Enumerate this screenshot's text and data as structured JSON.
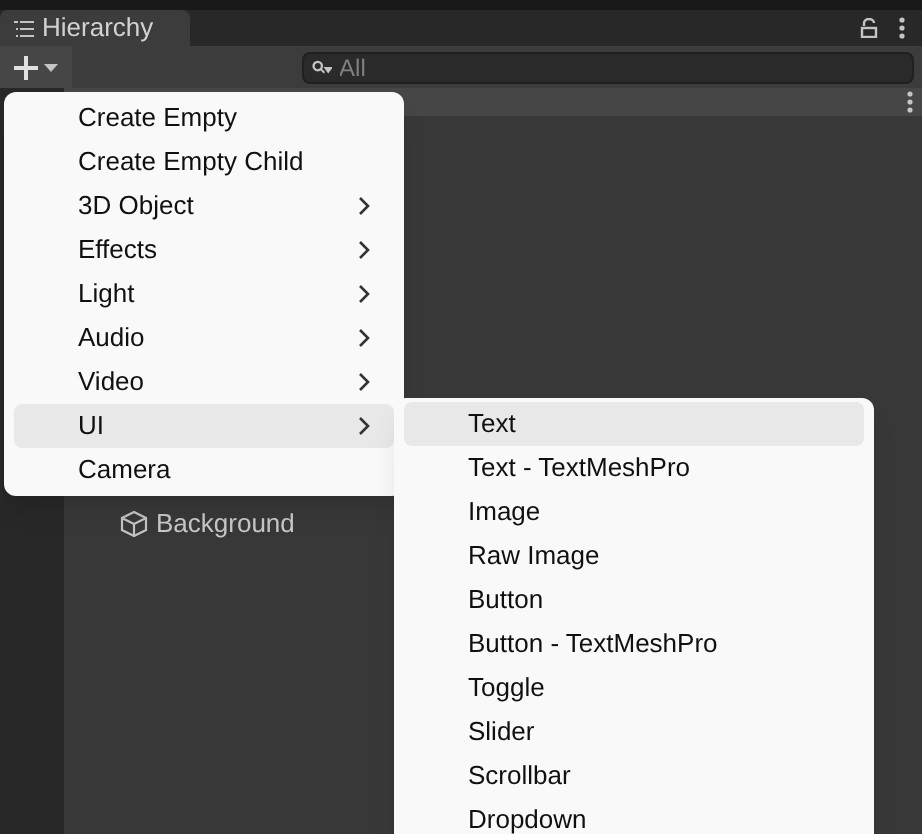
{
  "tab": {
    "title": "Hierarchy"
  },
  "search": {
    "placeholder": "All"
  },
  "tree": [
    {
      "label": "Background"
    }
  ],
  "menu": [
    {
      "label": "Create Empty",
      "submenu": false,
      "selected": false
    },
    {
      "label": "Create Empty Child",
      "submenu": false,
      "selected": false
    },
    {
      "label": "3D Object",
      "submenu": true,
      "selected": false
    },
    {
      "label": "Effects",
      "submenu": true,
      "selected": false
    },
    {
      "label": "Light",
      "submenu": true,
      "selected": false
    },
    {
      "label": "Audio",
      "submenu": true,
      "selected": false
    },
    {
      "label": "Video",
      "submenu": true,
      "selected": false
    },
    {
      "label": "UI",
      "submenu": true,
      "selected": true
    },
    {
      "label": "Camera",
      "submenu": false,
      "selected": false
    }
  ],
  "submenu": [
    {
      "label": "Text",
      "selected": true
    },
    {
      "label": "Text - TextMeshPro",
      "selected": false
    },
    {
      "label": "Image",
      "selected": false
    },
    {
      "label": "Raw Image",
      "selected": false
    },
    {
      "label": "Button",
      "selected": false
    },
    {
      "label": "Button - TextMeshPro",
      "selected": false
    },
    {
      "label": "Toggle",
      "selected": false
    },
    {
      "label": "Slider",
      "selected": false
    },
    {
      "label": "Scrollbar",
      "selected": false
    },
    {
      "label": "Dropdown",
      "selected": false
    }
  ]
}
